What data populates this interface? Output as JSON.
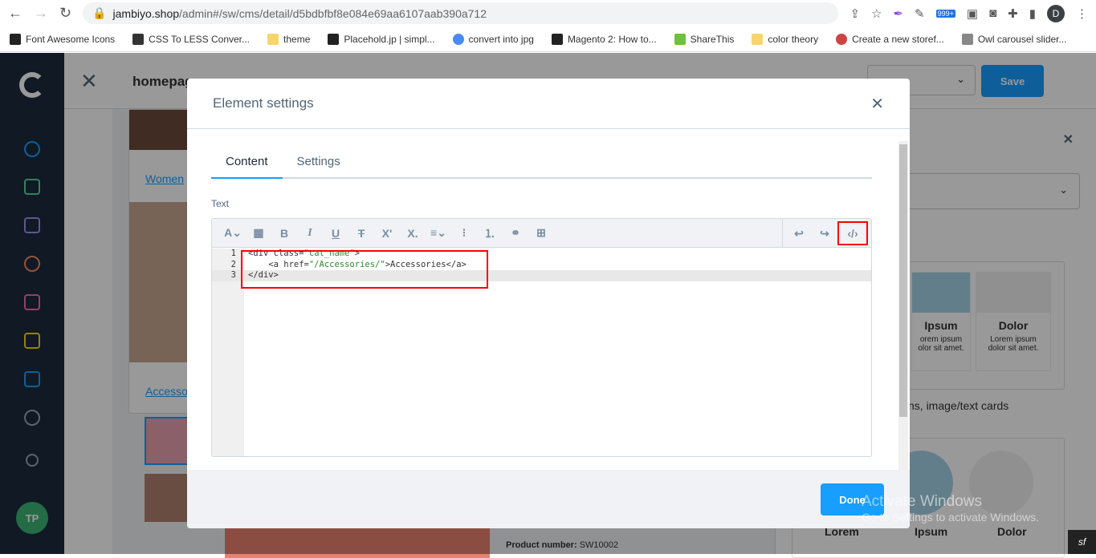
{
  "browser": {
    "url_host": "jambiyo.shop",
    "url_path": "/admin#/sw/cms/detail/d5bdbfbf8e084e69aa6107aab390a712",
    "badge": "999+",
    "profile": "D"
  },
  "bookmarks": [
    "Font Awesome Icons",
    "CSS To LESS Conver...",
    "theme",
    "Placehold.jp | simpl...",
    "convert into jpg",
    "Magento 2: How to...",
    "ShareThis",
    "color theory",
    "Create a new storef...",
    "Owl carousel slider..."
  ],
  "app": {
    "page_title": "homepag",
    "save_label": "Save",
    "user_initials": "TP",
    "link_women": "Women",
    "link_accessories": "Accesso",
    "product_number_label": "Product number:",
    "product_number": "SW10002",
    "right_section_text": "ns, image/text cards",
    "cards": [
      {
        "title": "Ipsum",
        "text": "orem ipsum olor sit amet."
      },
      {
        "title": "Dolor",
        "text": "Lorem ipsum dolor sit amet."
      }
    ],
    "card_labels": [
      "Lorem",
      "Ipsum",
      "Dolor"
    ]
  },
  "modal": {
    "title": "Element settings",
    "tabs": [
      "Content",
      "Settings"
    ],
    "active_tab": "Content",
    "text_label": "Text",
    "done_label": "Done",
    "code_lines": [
      {
        "n": "1",
        "pre": "<div class=",
        "str": "\"cat_name\"",
        "post": ">"
      },
      {
        "n": "2",
        "pre": "    <a href=",
        "str": "\"/Accessories/\"",
        "post": ">Accessories</a>"
      },
      {
        "n": "3",
        "pre": "</div>",
        "str": "",
        "post": ""
      }
    ]
  },
  "watermark": {
    "title": "Activate Windows",
    "subtitle": "Go to Settings to activate Windows."
  },
  "colors": {
    "accent": "#189eff",
    "sidebar": "#1b2a3d",
    "highlight": "#ff0000"
  }
}
